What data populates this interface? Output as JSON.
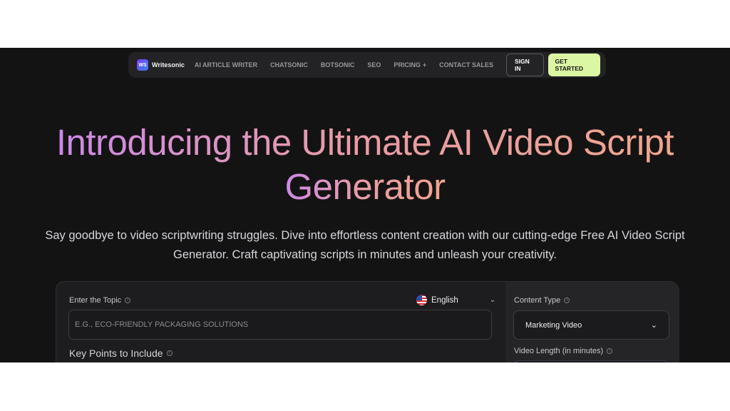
{
  "nav": {
    "logo_mark": "WS",
    "logo_text": "Writesonic",
    "links": [
      "AI ARTICLE WRITER",
      "CHATSONIC",
      "BOTSONIC",
      "SEO",
      "PRICING",
      "CONTACT SALES"
    ],
    "pricing_plus": "+",
    "sign_in": "SIGN IN",
    "get_started": "GET STARTED"
  },
  "hero": {
    "title_line1": "Introducing the Ultimate AI Video Script",
    "title_line2": "Generator",
    "subtitle_line1": "Say goodbye to video scriptwriting struggles. Dive into effortless content creation with our cutting-edge Free AI Video Script",
    "subtitle_line2": "Generator. Craft captivating scripts in minutes and unleash your creativity."
  },
  "form": {
    "topic_label": "Enter the Topic",
    "topic_placeholder": "E.G., ECO-FRIENDLY PACKAGING SOLUTIONS",
    "language": "English",
    "key_points_label": "Key Points to Include",
    "content_type_label": "Content Type",
    "content_type_value": "Marketing Video",
    "video_length_label": "Video Length (in minutes)",
    "info_glyph": "i",
    "chevron": "⌄"
  },
  "colors": {
    "background": "#141314",
    "accent_button": "#dcf7a3",
    "title_gradient_start": "#cc89e8",
    "title_gradient_end": "#f0a58d"
  }
}
